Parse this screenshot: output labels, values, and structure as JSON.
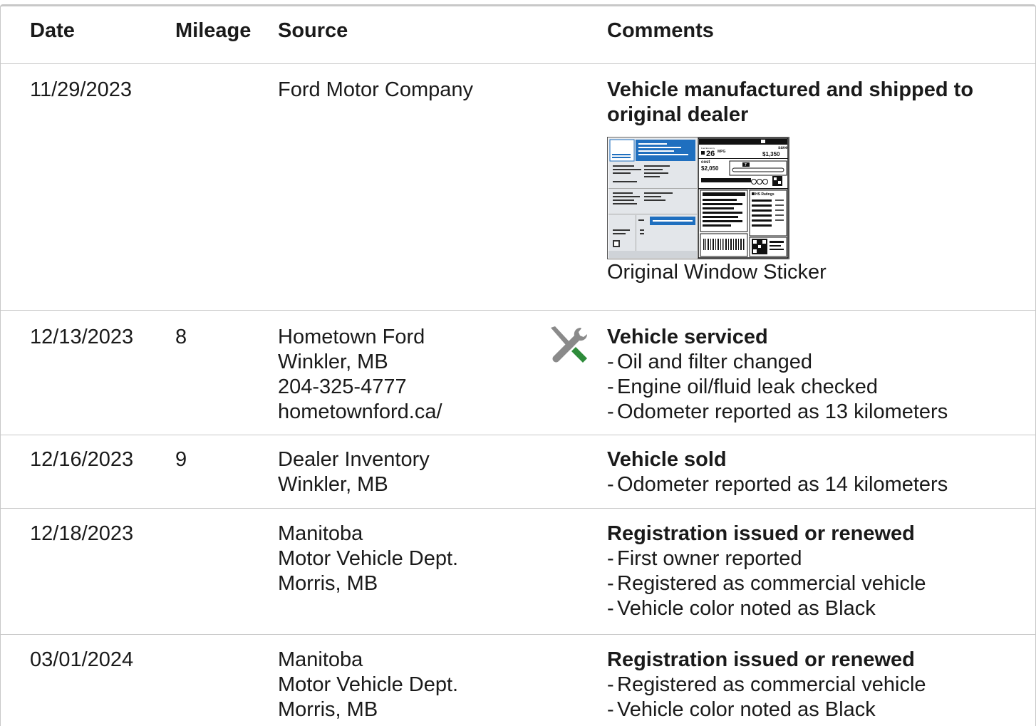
{
  "columns": {
    "date": "Date",
    "mileage": "Mileage",
    "source": "Source",
    "comments": "Comments"
  },
  "sticker": {
    "mpg": "26",
    "mpg_unit": "MPG",
    "save_label": "save",
    "save_value": "$1,350",
    "cost_label": "cost",
    "cost_value": "$2,050",
    "rating": "7",
    "ratings_label": "HS Ratings"
  },
  "rows": [
    {
      "date": "11/29/2023",
      "mileage": "",
      "source": [
        "Ford Motor Company"
      ],
      "title": "Vehicle manufactured and shipped to original dealer",
      "items": [],
      "attachment_caption": "Original Window Sticker"
    },
    {
      "date": "12/13/2023",
      "mileage": "8",
      "source": [
        "Hometown Ford",
        "Winkler, MB",
        "204-325-4777",
        "hometownford.ca/"
      ],
      "icon": "wrench-screwdriver-icon",
      "title": "Vehicle serviced",
      "items": [
        "Oil and filter changed",
        "Engine oil/fluid leak checked",
        "Odometer reported as 13 kilometers"
      ]
    },
    {
      "date": "12/16/2023",
      "mileage": "9",
      "source": [
        "Dealer Inventory",
        "Winkler, MB"
      ],
      "title": "Vehicle sold",
      "items": [
        "Odometer reported as 14 kilometers"
      ]
    },
    {
      "date": "12/18/2023",
      "mileage": "",
      "source": [
        "Manitoba",
        "Motor Vehicle Dept.",
        "Morris, MB"
      ],
      "title": "Registration issued or renewed",
      "items": [
        "First owner reported",
        "Registered as commercial vehicle",
        "Vehicle color noted as Black"
      ]
    },
    {
      "date": "03/01/2024",
      "mileage": "",
      "source": [
        "Manitoba",
        "Motor Vehicle Dept.",
        "Morris, MB"
      ],
      "title": "Registration issued or renewed",
      "items": [
        "Registered as commercial vehicle",
        "Vehicle color noted as Black"
      ]
    }
  ],
  "colors": {
    "accent_blue": "#1f6fbf",
    "icon_gray": "#8a8a8a",
    "icon_green": "#2e8b3a",
    "divider": "#c8c8c8"
  }
}
